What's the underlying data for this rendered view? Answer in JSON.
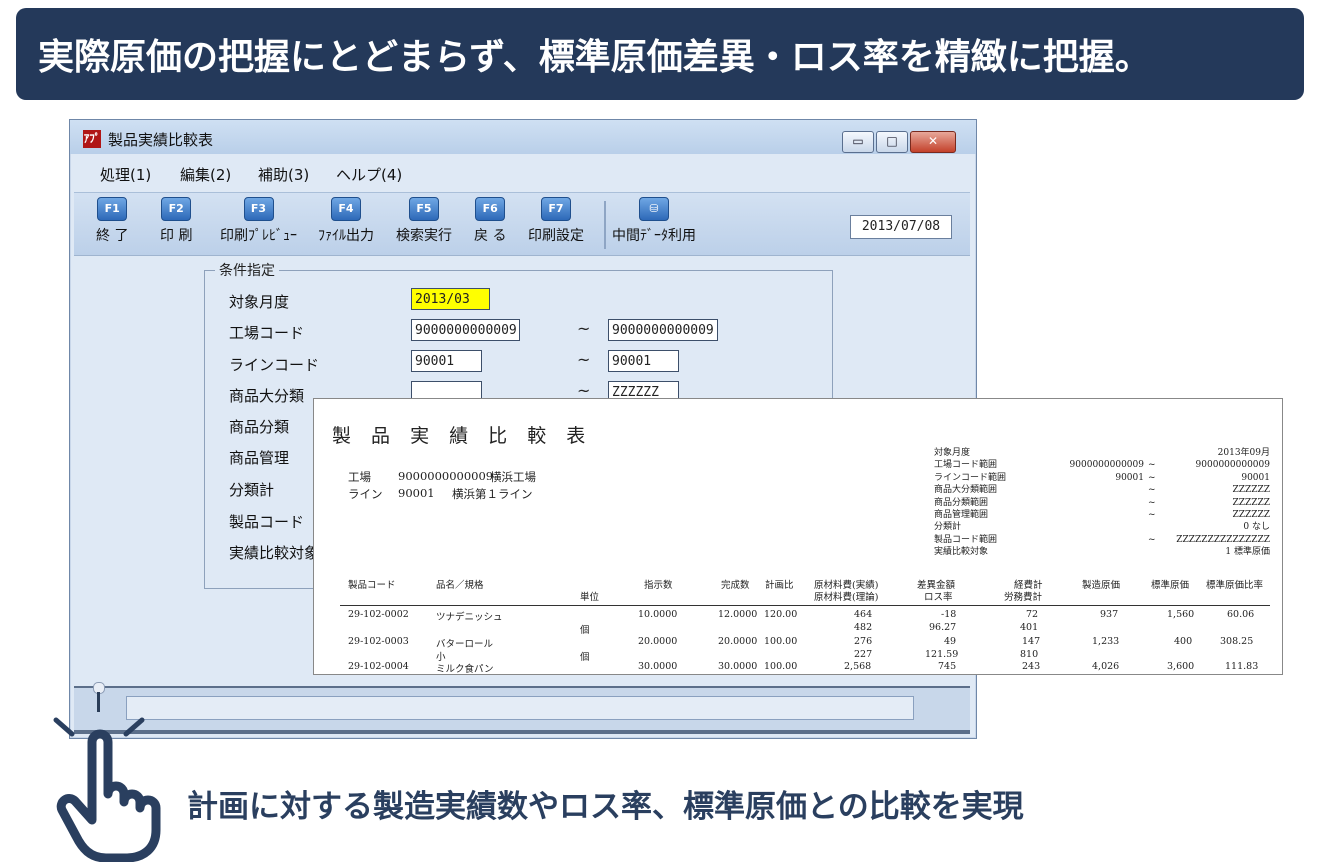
{
  "headline": "実際原価の把握にとどまらず、標準原価差異・ロス率を精緻に把握。",
  "window": {
    "title": "製品実績比較表",
    "logo": "ｱﾌﾟ",
    "controls": {
      "minimize": "▭",
      "maximize": "□",
      "close": "✕"
    }
  },
  "menu": [
    {
      "label": "処理(1)"
    },
    {
      "label": "編集(2)"
    },
    {
      "label": "補助(3)"
    },
    {
      "label": "ヘルプ(4)"
    }
  ],
  "toolbar": {
    "keys": [
      {
        "key": "F1",
        "label": "終 了"
      },
      {
        "key": "F2",
        "label": "印 刷"
      },
      {
        "key": "F3",
        "label": "印刷ﾌﾟﾚﾋﾞｭｰ"
      },
      {
        "key": "F4",
        "label": "ﾌｧｲﾙ出力"
      },
      {
        "key": "F5",
        "label": "検索実行"
      },
      {
        "key": "F6",
        "label": "戻 る"
      },
      {
        "key": "F7",
        "label": "印刷設定"
      }
    ],
    "middata_label": "中間ﾃﾞｰﾀ利用",
    "date": "2013/07/08"
  },
  "conditions": {
    "legend": "条件指定",
    "labels": [
      "対象月度",
      "工場コード",
      "ラインコード",
      "商品大分類",
      "商品分類",
      "商品管理",
      "分類計",
      "製品コード",
      "実績比較対象"
    ],
    "target_month": "2013/03",
    "factory_from": "9000000000009",
    "factory_to": "9000000000009",
    "line_from": "90001",
    "line_to": "90001",
    "category_from": "",
    "category_to": "ZZZZZZ",
    "tilde": "~"
  },
  "report": {
    "title": "製 品 実 績 比 較 表",
    "factory_label": "工場",
    "factory_code": "9000000000009",
    "factory_name": "横浜工場",
    "line_label": "ライン",
    "line_code": "90001",
    "line_name": "横浜第１ライン",
    "meta": [
      {
        "label": "対象月度",
        "from": "",
        "tilde": "",
        "to": "2013年09月"
      },
      {
        "label": "工場コード範囲",
        "from": "9000000000009",
        "tilde": "~",
        "to": "9000000000009"
      },
      {
        "label": "ラインコード範囲",
        "from": "90001",
        "tilde": "~",
        "to": "90001"
      },
      {
        "label": "商品大分類範囲",
        "from": "",
        "tilde": "~",
        "to": "ZZZZZZ"
      },
      {
        "label": "商品分類範囲",
        "from": "",
        "tilde": "~",
        "to": "ZZZZZZ"
      },
      {
        "label": "商品管理範囲",
        "from": "",
        "tilde": "~",
        "to": "ZZZZZZ"
      },
      {
        "label": "分類計",
        "from": "",
        "tilde": "",
        "to": "0 なし"
      },
      {
        "label": "製品コード範囲",
        "from": "",
        "tilde": "~",
        "to": "ZZZZZZZZZZZZZZZ"
      },
      {
        "label": "実績比較対象",
        "from": "",
        "tilde": "",
        "to": "1 標準原価"
      }
    ],
    "columns": {
      "code": "製品コード",
      "name": "品名／規格",
      "unit": "単位",
      "plan": "指示数",
      "done": "完成数",
      "ratio": "計画比",
      "material1": "原材料費(実績)",
      "material2": "原材料費(理論)",
      "diff1": "差異金額",
      "diff2": "ロス率",
      "exp1": "経費計",
      "exp2": "労務費計",
      "mfg": "製造原価",
      "std": "標準原価",
      "stdratio": "標準原価比率"
    },
    "rows": [
      {
        "code": "29-102-0002",
        "name": "ツナデニッシュ",
        "unit": "個",
        "plan": "10.0000",
        "done": "12.0000",
        "ratio": "120.00",
        "m1": "464",
        "m2": "482",
        "d1": "-18",
        "d2": "96.27",
        "e1": "72",
        "e2": "401",
        "mfg": "937",
        "std": "1,560",
        "sr": "60.06"
      },
      {
        "code": "29-102-0003",
        "name": "バターロール",
        "name2": "小",
        "unit": "個",
        "plan": "20.0000",
        "done": "20.0000",
        "ratio": "100.00",
        "m1": "276",
        "m2": "227",
        "d1": "49",
        "d2": "121.59",
        "e1": "147",
        "e2": "810",
        "mfg": "1,233",
        "std": "400",
        "sr": "308.25"
      },
      {
        "code": "29-102-0004",
        "name": "ミルク食パン",
        "unit": "",
        "plan": "30.0000",
        "done": "30.0000",
        "ratio": "100.00",
        "m1": "2,568",
        "m2": "",
        "d1": "745",
        "d2": "",
        "e1": "243",
        "e2": "",
        "mfg": "4,026",
        "std": "3,600",
        "sr": "111.83"
      }
    ]
  },
  "bottom_text": "計画に対する製造実績数やロス率、標準原価との比較を実現"
}
